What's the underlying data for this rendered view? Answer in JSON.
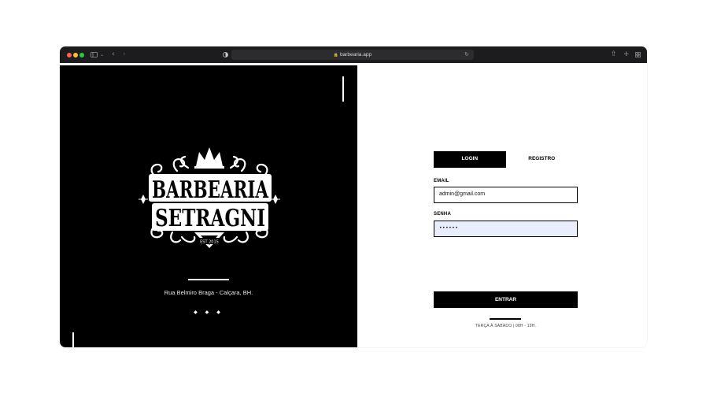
{
  "browser": {
    "url": "barbearia.app",
    "traffic_lights": [
      "#ff5f57",
      "#febc2e",
      "#28c840"
    ],
    "icons": [
      "sidebar-icon",
      "chevron-down-icon",
      "back-icon",
      "forward-icon",
      "privacy-shield-icon",
      "lock-icon",
      "reload-icon",
      "share-icon",
      "plus-icon",
      "tabs-grid-icon"
    ]
  },
  "brand": {
    "line1": "BARBEARIA",
    "line2": "SETRAGNI",
    "est": "EST 2015",
    "address": "Rua Belmiro Braga - Calçara, BH.",
    "diamonds": "◆ ◆ ◆"
  },
  "form": {
    "tabs": [
      {
        "label": "LOGIN",
        "active": true
      },
      {
        "label": "REGISTRO",
        "active": false
      }
    ],
    "email_label": "EMAIL",
    "email_value": "admin@gmail.com",
    "password_label": "SENHA",
    "password_value": "••••••",
    "submit_label": "ENTRAR",
    "hours": "TERÇA À SÁBADO | 08H - 19H."
  },
  "colors": {
    "panel": "#000000",
    "accent": "#000000",
    "autofill": "#e8eefc"
  }
}
